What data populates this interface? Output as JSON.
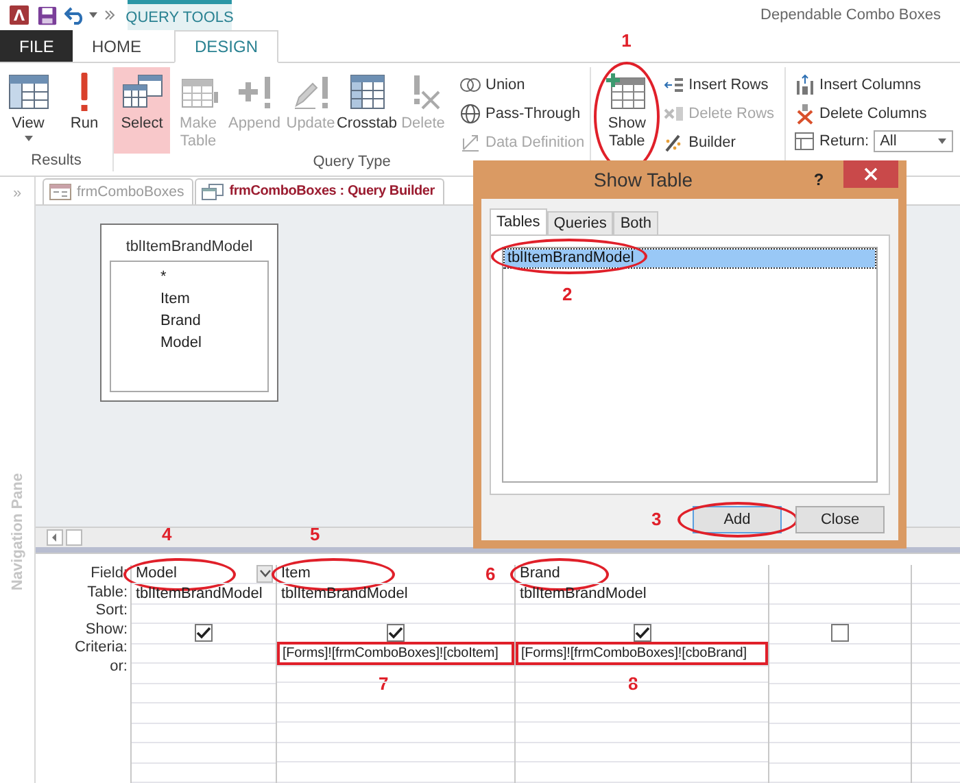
{
  "app_title": "Dependable Combo Boxes",
  "contextual_tab": "QUERY TOOLS",
  "ribbon_tabs": [
    {
      "label": "FILE",
      "kind": "file",
      "selected": false
    },
    {
      "label": "HOME",
      "kind": "tab",
      "selected": false
    },
    {
      "label": "DESIGN",
      "kind": "tab",
      "selected": true
    }
  ],
  "ribbon": {
    "results": {
      "label": "Results",
      "buttons": [
        {
          "label": "View"
        },
        {
          "label": "Run"
        }
      ]
    },
    "query_type": {
      "label": "Query Type",
      "large": [
        {
          "label": "Select",
          "selected": true,
          "disabled": false
        },
        {
          "label": "Make Table",
          "selected": false,
          "disabled": true
        },
        {
          "label": "Append",
          "selected": false,
          "disabled": true
        },
        {
          "label": "Update",
          "selected": false,
          "disabled": true
        },
        {
          "label": "Crosstab",
          "selected": false,
          "disabled": false
        },
        {
          "label": "Delete",
          "selected": false,
          "disabled": true
        }
      ],
      "small": [
        {
          "label": "Union",
          "disabled": false
        },
        {
          "label": "Pass-Through",
          "disabled": false
        },
        {
          "label": "Data Definition",
          "disabled": true
        }
      ]
    },
    "query_setup": {
      "show_table": {
        "label": "Show Table",
        "callout": "1"
      },
      "row_commands": [
        {
          "label": "Insert Rows",
          "disabled": false
        },
        {
          "label": "Delete Rows",
          "disabled": true
        },
        {
          "label": "Builder",
          "disabled": false
        }
      ],
      "column_commands": [
        {
          "label": "Insert Columns",
          "disabled": false
        },
        {
          "label": "Delete Columns",
          "disabled": false
        }
      ],
      "return": {
        "label": "Return:",
        "value": "All"
      }
    }
  },
  "nav_pane": {
    "expand": "»",
    "label": "Navigation Pane"
  },
  "doc_tabs": [
    {
      "label": "frmComboBoxes",
      "selected": false
    },
    {
      "label": "frmComboBoxes : Query Builder",
      "selected": true
    }
  ],
  "table_box": {
    "title": "tblItemBrandModel",
    "fields": [
      "*",
      "Item",
      "Brand",
      "Model"
    ]
  },
  "grid": {
    "row_labels": [
      "Field:",
      "Table:",
      "Sort:",
      "Show:",
      "Criteria:",
      "or:"
    ],
    "columns": [
      {
        "field": "Model",
        "table": "tblItemBrandModel",
        "show": true,
        "active": true,
        "field_callout": "4"
      },
      {
        "field": "Item",
        "table": "tblItemBrandModel",
        "show": true,
        "active": false,
        "field_callout": "5",
        "criteria": "[Forms]![frmComboBoxes]![cboItem]",
        "criteria_callout": "7"
      },
      {
        "field": "Brand",
        "table": "tblItemBrandModel",
        "show": true,
        "active": false,
        "field_callout": "6",
        "criteria": "[Forms]![frmComboBoxes]![cboBrand]",
        "criteria_callout": "8"
      },
      {
        "show": false,
        "active": false
      }
    ]
  },
  "dialog": {
    "title": "Show Table",
    "help": "?",
    "tabs": [
      {
        "label": "Tables",
        "selected": true
      },
      {
        "label": "Queries",
        "selected": false
      },
      {
        "label": "Both",
        "selected": false
      }
    ],
    "items": [
      {
        "label": "tblItemBrandModel",
        "selected": true,
        "callout": "2"
      }
    ],
    "buttons": [
      {
        "label": "Add",
        "default": true,
        "callout": "3"
      },
      {
        "label": "Close",
        "default": false
      }
    ]
  }
}
